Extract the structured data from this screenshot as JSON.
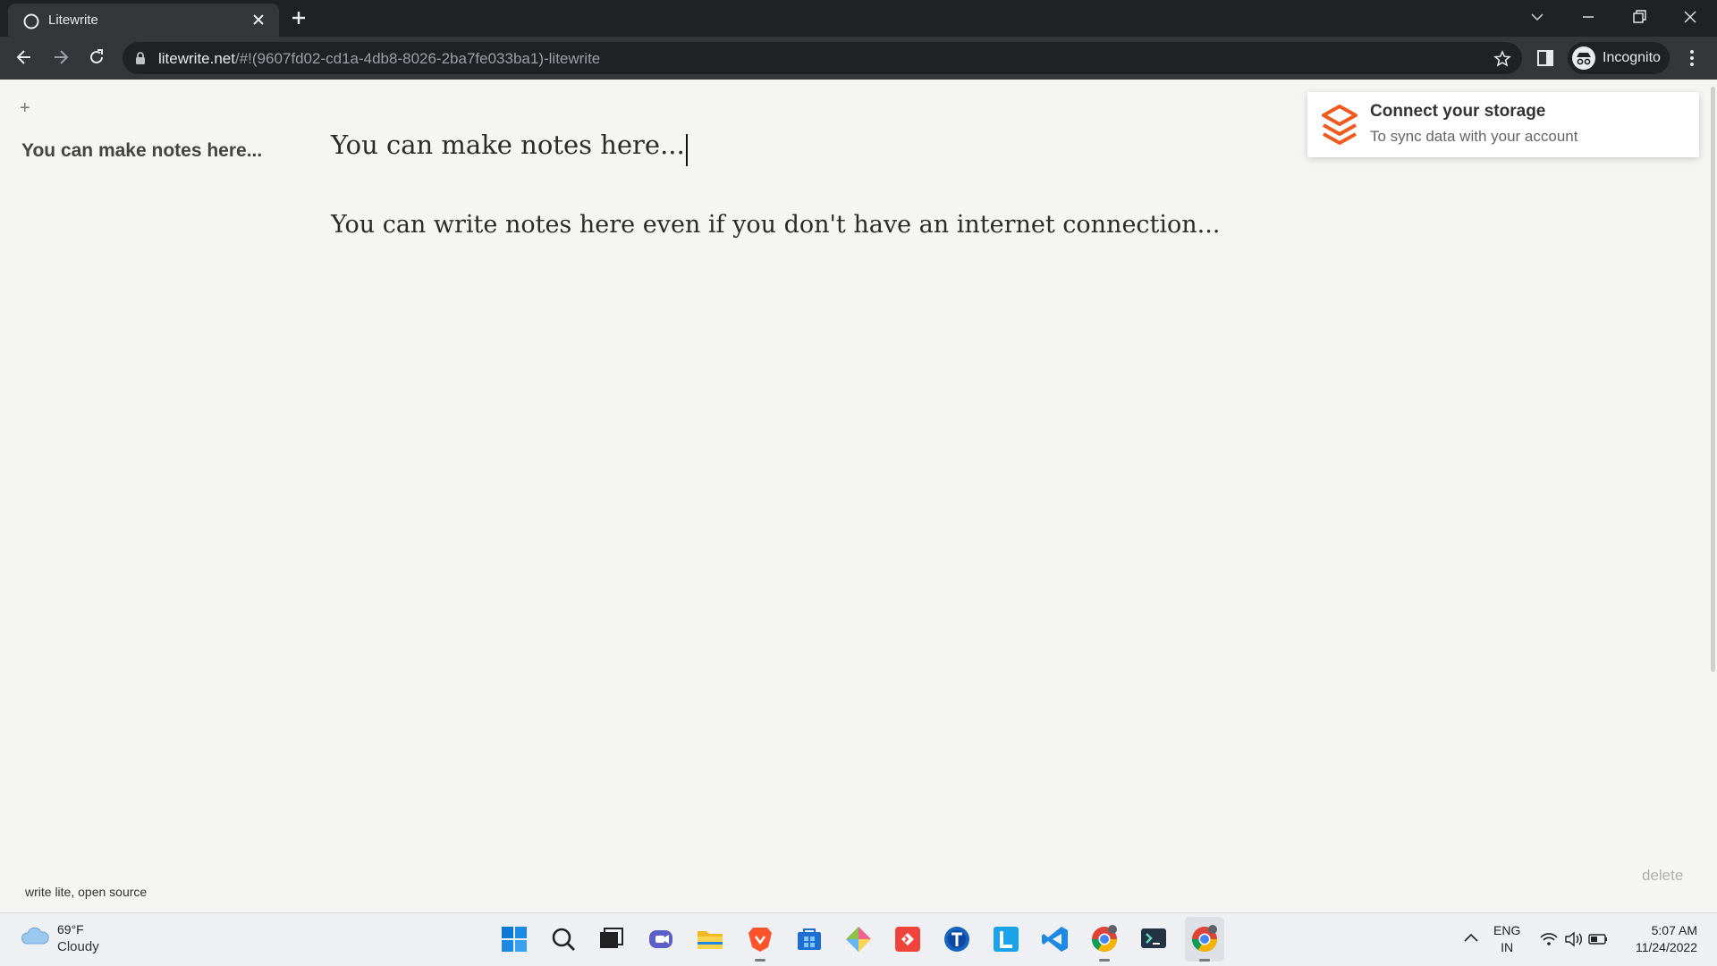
{
  "browser": {
    "tab_title": "Litewrite",
    "url_host": "litewrite.net",
    "url_path": "/#!(9607fd02-cd1a-4db8-8026-2ba7fe033ba1)-litewrite",
    "profile_label": "Incognito"
  },
  "app": {
    "add_note_symbol": "+",
    "notes": [
      {
        "title": "You can make notes here..."
      }
    ],
    "editor": {
      "title": "You can make notes here...",
      "body": "You can write notes here even if you don't have an internet connection..."
    },
    "footer": "write lite, open source",
    "delete_label": "delete",
    "storage_toast": {
      "title": "Connect your storage",
      "subtitle": "To sync data with your account"
    }
  },
  "taskbar": {
    "weather": {
      "temp": "69°F",
      "condition": "Cloudy"
    },
    "language": {
      "line1": "ENG",
      "line2": "IN"
    },
    "clock": {
      "time": "5:07 AM",
      "date": "11/24/2022"
    },
    "pinned_icons": [
      "windows-start-icon",
      "search-icon",
      "task-view-icon",
      "teams-chat-icon",
      "file-explorer-icon",
      "brave-browser-icon",
      "store-icon",
      "git-icon",
      "anydesk-icon",
      "tor-icon",
      "launcher-l-icon",
      "vscode-icon",
      "chrome-icon",
      "terminal-icon",
      "chrome-active-icon"
    ]
  },
  "colors": {
    "accent_orange": "#ef5a1e",
    "chrome_dark": "#202124",
    "toolbar_dark": "#35363a",
    "page_bg": "#f5f5f3"
  }
}
